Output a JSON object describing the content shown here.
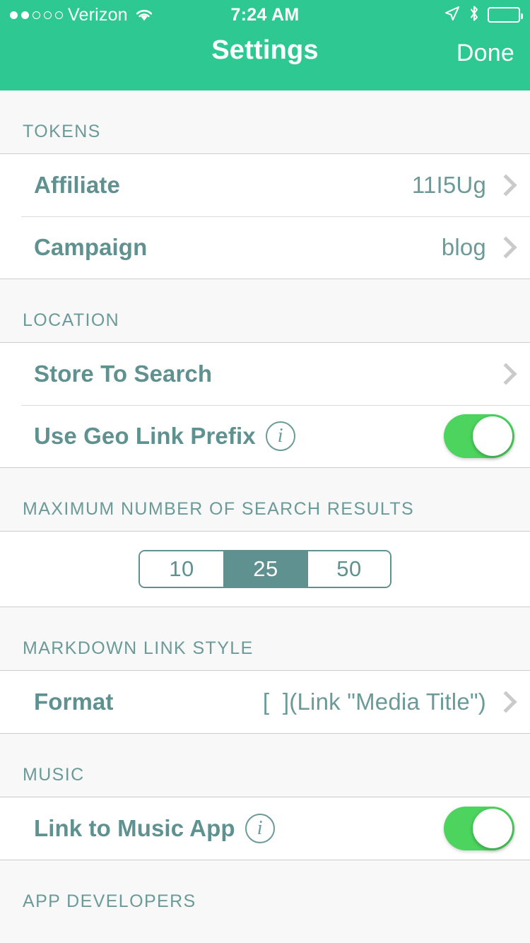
{
  "status_bar": {
    "signal_dots_filled": 2,
    "signal_dots_total": 5,
    "carrier": "Verizon",
    "wifi_icon": "wifi-icon",
    "time": "7:24 AM",
    "location_icon": "location-arrow-icon",
    "bluetooth_icon": "bluetooth-icon",
    "battery_icon": "battery-full-icon"
  },
  "navbar": {
    "title": "Settings",
    "done_label": "Done",
    "background_color": "#2ec993"
  },
  "sections": [
    {
      "header": "TOKENS",
      "rows": [
        {
          "label": "Affiliate",
          "value": "11I5Ug",
          "accessory": "chevron"
        },
        {
          "label": "Campaign",
          "value": "blog",
          "accessory": "chevron"
        }
      ]
    },
    {
      "header": "LOCATION",
      "rows": [
        {
          "label": "Store To Search",
          "value": "",
          "accessory": "chevron"
        },
        {
          "label": "Use Geo Link Prefix",
          "info_icon": "info-icon",
          "accessory": "toggle",
          "toggle_on": true
        }
      ]
    },
    {
      "header": "MAXIMUM NUMBER OF SEARCH RESULTS",
      "segmented": {
        "options": [
          "10",
          "25",
          "50"
        ],
        "selected": "25"
      }
    },
    {
      "header": "MARKDOWN LINK STYLE",
      "rows": [
        {
          "label": "Format",
          "value": "[  ](Link \"Media Title\")",
          "accessory": "chevron"
        }
      ]
    },
    {
      "header": "MUSIC",
      "rows": [
        {
          "label": "Link to Music App",
          "info_icon": "info-icon",
          "accessory": "toggle",
          "toggle_on": true
        }
      ]
    },
    {
      "header": "APP DEVELOPERS",
      "rows": []
    }
  ],
  "colors": {
    "brand_green": "#2ec993",
    "toggle_green": "#4cd45e",
    "teal_text": "#5f9190",
    "section_header_text": "#6b9a98",
    "page_background": "#f7f8f7"
  }
}
